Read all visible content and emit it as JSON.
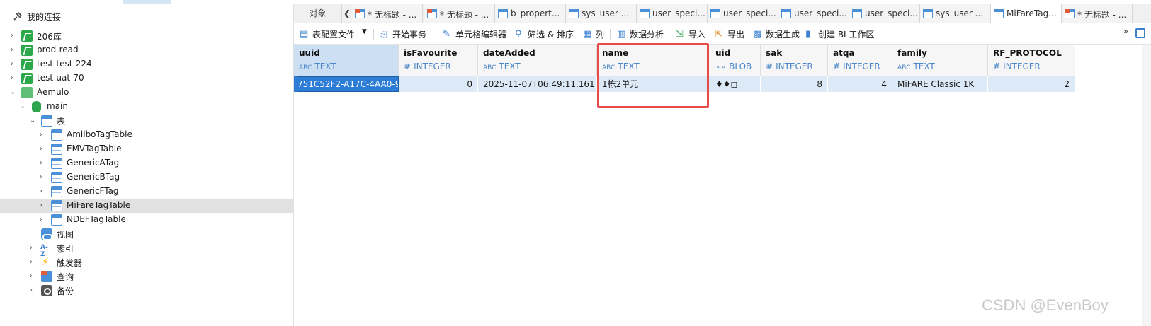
{
  "sidebar": {
    "header": "我的连接",
    "connections": [
      "206库",
      "prod-read",
      "test-test-224",
      "test-uat-70",
      "Aemulo"
    ],
    "schema": "main",
    "tables_group": "表",
    "tables": [
      "AmiiboTagTable",
      "EMVTagTable",
      "GenericATag",
      "GenericBTag",
      "GenericFTag",
      "MiFareTagTable",
      "NDEFTagTable"
    ],
    "selected_table": "MiFareTagTable",
    "groups": [
      "视图",
      "索引",
      "触发器",
      "查询",
      "备份"
    ]
  },
  "tabs": {
    "objects": "对象",
    "items": [
      {
        "label": "* 无标题 - ...",
        "icon": "query-icon"
      },
      {
        "label": "* 无标题 - ...",
        "icon": "query-icon"
      },
      {
        "label": "b_propert...",
        "icon": "table-icon"
      },
      {
        "label": "sys_user ...",
        "icon": "table-icon"
      },
      {
        "label": "user_speci...",
        "icon": "table-icon"
      },
      {
        "label": "user_speci...",
        "icon": "table-icon"
      },
      {
        "label": "user_speci...",
        "icon": "table-icon"
      },
      {
        "label": "user_speci...",
        "icon": "table-icon"
      },
      {
        "label": "sys_user ...",
        "icon": "table-icon"
      },
      {
        "label": "MiFareTag...",
        "icon": "table-icon",
        "active": true
      },
      {
        "label": "* 无标题 - ...",
        "icon": "query-icon"
      }
    ]
  },
  "toolbar": {
    "table_config": "表配置文件",
    "begin_tx": "开始事务",
    "cell_editor": "单元格编辑器",
    "filter_sort": "筛选 & 排序",
    "columns": "列",
    "analysis": "数据分析",
    "import": "导入",
    "export": "导出",
    "generate": "数据生成",
    "bi": "创建 BI 工作区",
    "more": "»"
  },
  "grid": {
    "columns": [
      {
        "name": "uuid",
        "type": "TEXT",
        "type_icon": "ABC"
      },
      {
        "name": "isFavourite",
        "type": "INTEGER",
        "type_icon": "#"
      },
      {
        "name": "dateAdded",
        "type": "TEXT",
        "type_icon": "ABC"
      },
      {
        "name": "name",
        "type": "TEXT",
        "type_icon": "ABC"
      },
      {
        "name": "uid",
        "type": "BLOB",
        "type_icon": "blob"
      },
      {
        "name": "sak",
        "type": "INTEGER",
        "type_icon": "#"
      },
      {
        "name": "atqa",
        "type": "INTEGER",
        "type_icon": "#"
      },
      {
        "name": "family",
        "type": "TEXT",
        "type_icon": "ABC"
      },
      {
        "name": "RF_PROTOCOL",
        "type": "INTEGER",
        "type_icon": "#"
      }
    ],
    "rows": [
      [
        "751C52F2-A17C-4AA0-9",
        "0",
        "2025-11-07T06:49:11.161",
        "1栋2单元",
        "♦♦◻",
        "8",
        "4",
        "MiFARE Classic 1K",
        "2"
      ]
    ]
  },
  "watermark": "CSDN @EvenBoy",
  "colors": {
    "accent": "#2d7cd6",
    "highlight": "#e94b4b",
    "row_bg": "#dceaf8"
  }
}
